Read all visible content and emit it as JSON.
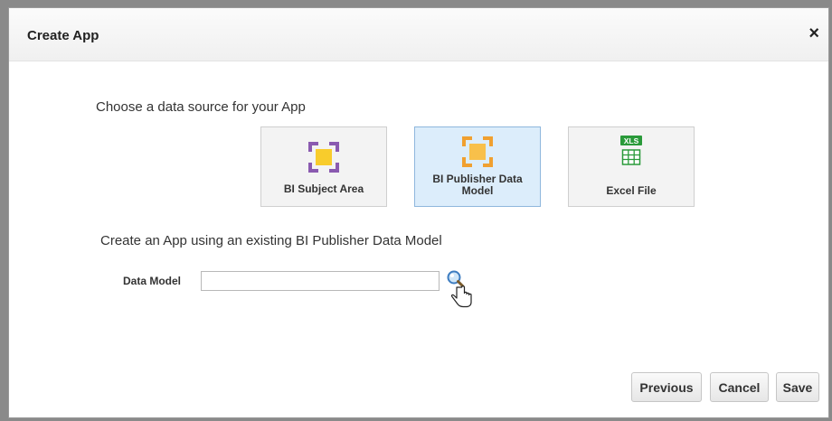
{
  "dialog": {
    "title": "Create App",
    "close_label": "×"
  },
  "source": {
    "prompt": "Choose a data source for your App",
    "options": [
      {
        "label": "BI Subject Area",
        "icon": "subject-area-icon",
        "color": "#8a5ab0",
        "selected": false
      },
      {
        "label": "BI Publisher Data Model",
        "icon": "data-model-icon",
        "color": "#f0a030",
        "selected": true
      },
      {
        "label": "Excel File",
        "icon": "excel-file-icon",
        "badge": "XLS",
        "color": "#2a9a3a",
        "selected": false
      }
    ]
  },
  "form": {
    "prompt": "Create an App using an existing BI Publisher Data Model",
    "data_model_label": "Data Model",
    "data_model_value": ""
  },
  "footer": {
    "previous_label": "Previous",
    "cancel_label": "Cancel",
    "save_label": "Save"
  }
}
